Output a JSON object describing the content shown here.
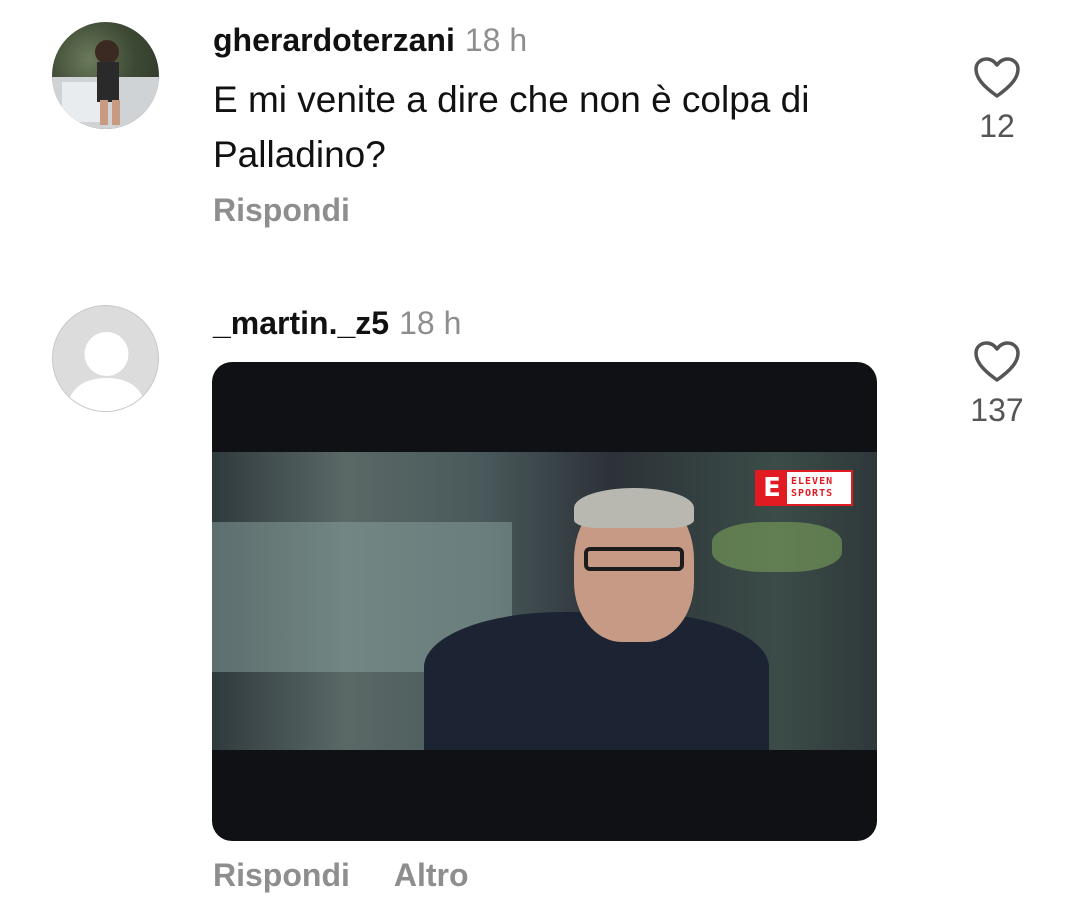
{
  "comments": [
    {
      "username": "gherardoterzani",
      "time": "18 h",
      "text": "E mi venite a dire che non è colpa di Palladino?",
      "likes": "12",
      "actions": {
        "reply": "Rispondi"
      },
      "avatar": "user-photo"
    },
    {
      "username": "_martin._z5",
      "time": "18 h",
      "likes": "137",
      "media": {
        "type": "gif",
        "logo_lines": [
          "ELEVEN",
          "SPORTS"
        ],
        "logo_letter": "E"
      },
      "actions": {
        "reply": "Rispondi",
        "more": "Altro"
      },
      "avatar": "default-avatar"
    }
  ],
  "icons": {
    "like": "heart-outline-icon"
  },
  "colors": {
    "text": "#111111",
    "muted": "#8e8e8e",
    "like_count": "#555555",
    "media_bg": "#101114",
    "logo_red": "#e21b23"
  }
}
